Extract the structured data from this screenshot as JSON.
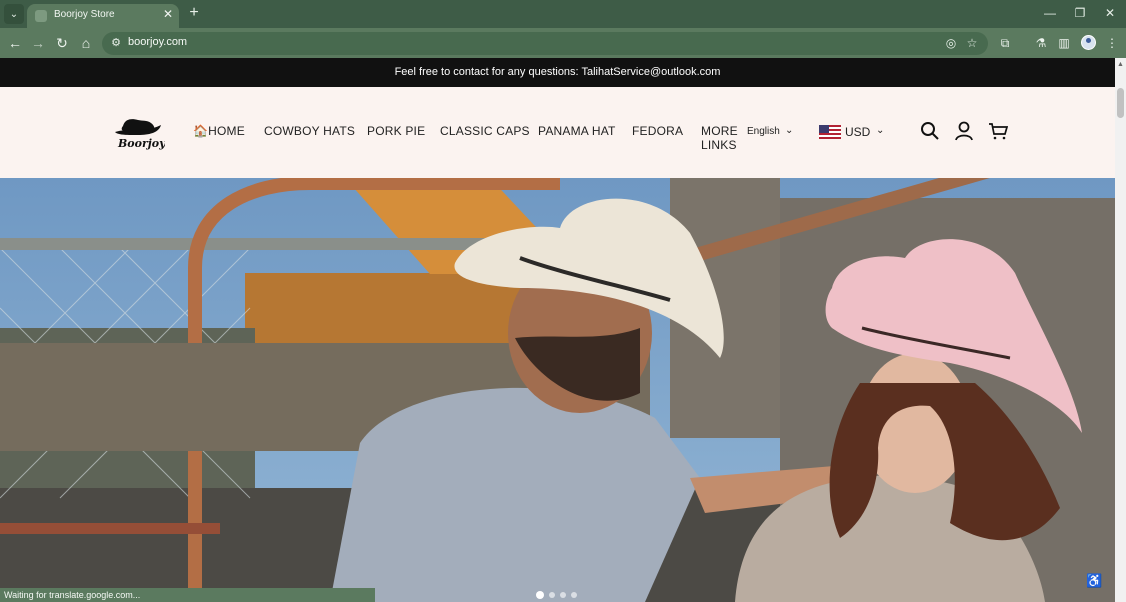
{
  "browser": {
    "tab_title": "Boorjoy Store",
    "url": "boorjoy.com",
    "status_text": "Waiting for translate.google.com..."
  },
  "announcement": "Feel free to contact for any questions: TalihatService@outlook.com",
  "header": {
    "nav": [
      "🏠HOME",
      "COWBOY HATS",
      "PORK PIE",
      "CLASSIC CAPS",
      "PANAMA HAT",
      "FEDORA",
      "MORE LINKS"
    ],
    "language": "English",
    "currency": "USD"
  },
  "hero": {
    "slides": 4,
    "active_slide": 1
  },
  "colors": {
    "tabbar": "#3e5c47",
    "toolbar": "#5b7a5f",
    "announcement_bg": "#111111",
    "header_bg": "#fbf3f0"
  }
}
